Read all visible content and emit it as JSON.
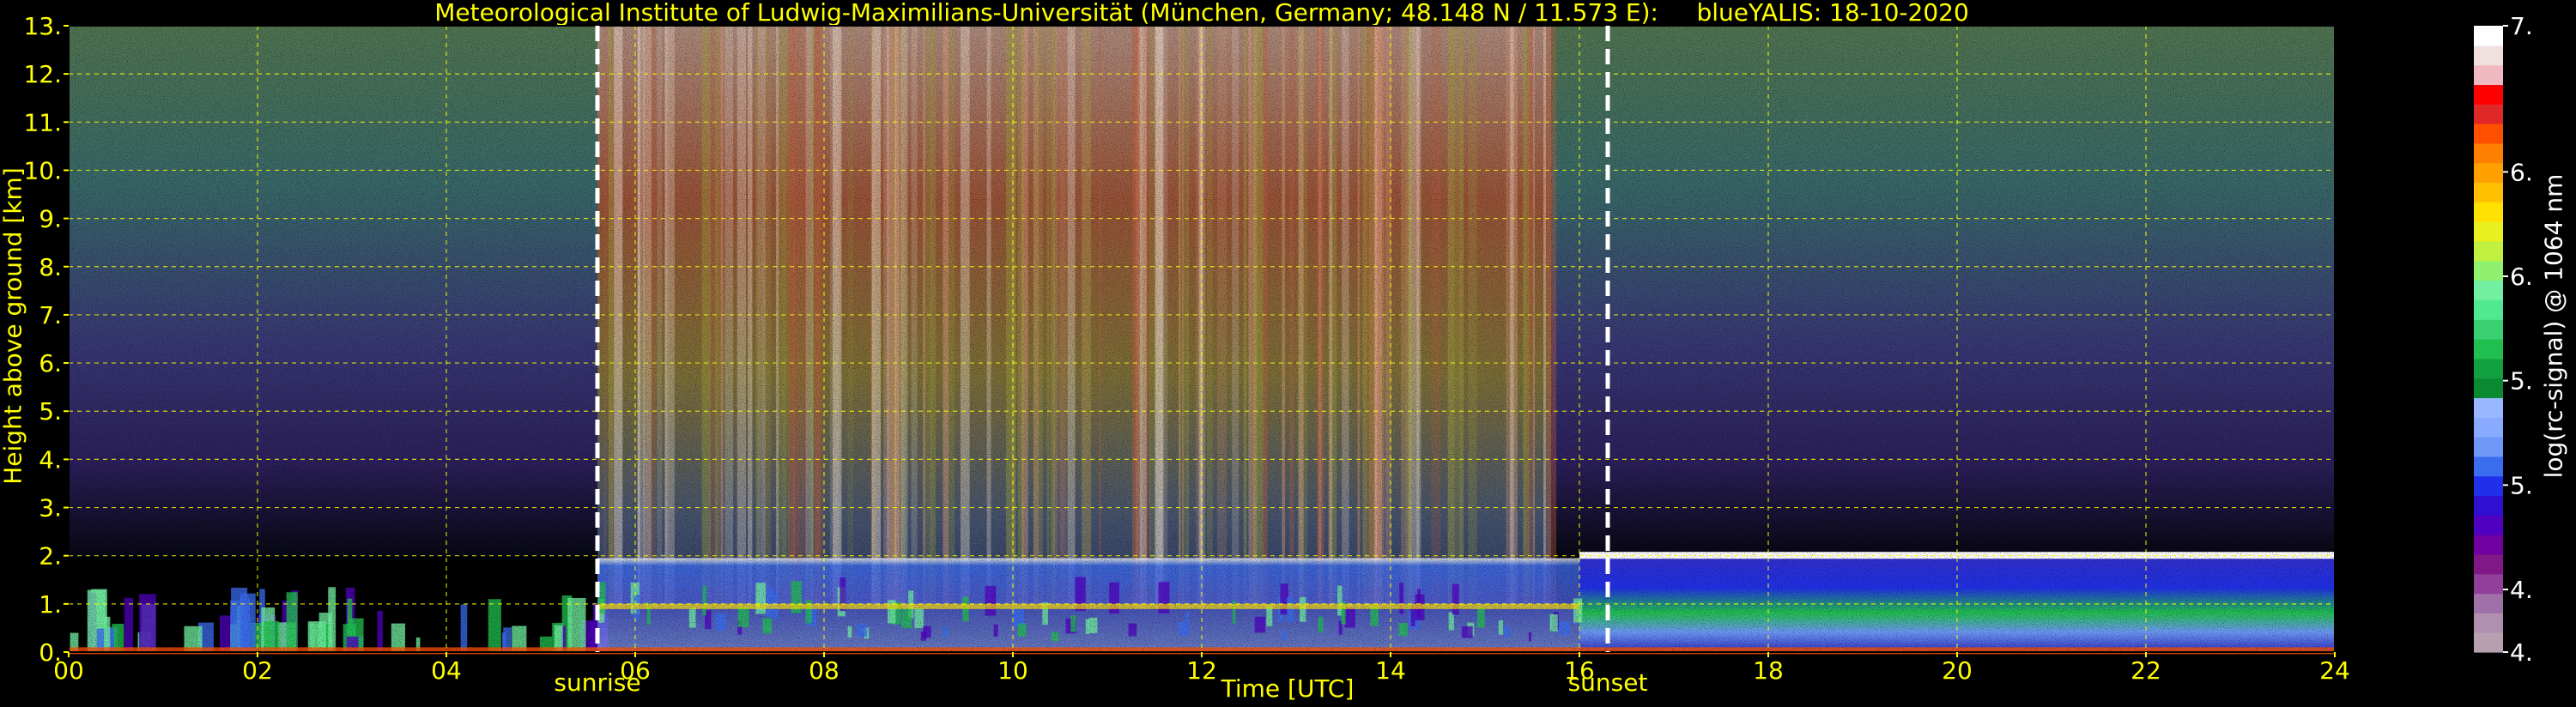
{
  "page": {
    "title": "Meteorological Institute of Ludwig-Maximilians-Universität (München, Germany; 48.148 N / 11.573 E):     blueYALIS: 18-10-2020"
  },
  "chart_data": {
    "type": "heatmap",
    "title": "Meteorological Institute of Ludwig-Maximilians-Universität (München, Germany; 48.148 N / 11.573 E):     blueYALIS: 18-10-2020",
    "xlabel": "Time [UTC]",
    "ylabel": "Height above ground [km]",
    "xlim": [
      0,
      24
    ],
    "ylim": [
      0,
      13
    ],
    "x_ticks": [
      {
        "value": 0,
        "label": "00"
      },
      {
        "value": 2,
        "label": "02"
      },
      {
        "value": 4,
        "label": "04"
      },
      {
        "value": 6,
        "label": "06"
      },
      {
        "value": 8,
        "label": "08"
      },
      {
        "value": 10,
        "label": "10"
      },
      {
        "value": 12,
        "label": "12"
      },
      {
        "value": 14,
        "label": "14"
      },
      {
        "value": 16,
        "label": "16"
      },
      {
        "value": 18,
        "label": "18"
      },
      {
        "value": 20,
        "label": "20"
      },
      {
        "value": 22,
        "label": "22"
      },
      {
        "value": 24,
        "label": "24"
      }
    ],
    "y_ticks": [
      {
        "value": 0,
        "label": "0."
      },
      {
        "value": 1,
        "label": "1."
      },
      {
        "value": 2,
        "label": "2."
      },
      {
        "value": 3,
        "label": "3."
      },
      {
        "value": 4,
        "label": "4."
      },
      {
        "value": 5,
        "label": "5."
      },
      {
        "value": 6,
        "label": "6."
      },
      {
        "value": 7,
        "label": "7."
      },
      {
        "value": 8,
        "label": "8."
      },
      {
        "value": 9,
        "label": "9."
      },
      {
        "value": 10,
        "label": "10."
      },
      {
        "value": 11,
        "label": "11."
      },
      {
        "value": 12,
        "label": "12."
      },
      {
        "value": 13,
        "label": "13."
      }
    ],
    "grid": true,
    "grid_color": "#ffff00",
    "axis_text_color": "#ffff00",
    "annotations": [
      {
        "label": "sunrise",
        "x": 5.6
      },
      {
        "label": "sunset",
        "x": 16.3
      }
    ],
    "colorbar": {
      "label": "log(rc-signal) @ 1064 nm",
      "range": [
        4.2,
        7.2
      ],
      "ticks": [
        {
          "value": 4.2,
          "label": "4.2"
        },
        {
          "value": 4.5,
          "label": "4.5"
        },
        {
          "value": 5.0,
          "label": "5.0"
        },
        {
          "value": 5.5,
          "label": "5.5"
        },
        {
          "value": 6.0,
          "label": "6.0"
        },
        {
          "value": 6.5,
          "label": "6.5"
        },
        {
          "value": 7.2,
          "label": "7.2"
        }
      ],
      "colors": [
        "#b8a0b0",
        "#b090b0",
        "#a070a8",
        "#904098",
        "#801888",
        "#7000a0",
        "#5000c0",
        "#3010d0",
        "#2030e8",
        "#3a6cf0",
        "#6d98f8",
        "#88aaff",
        "#9ab8ff",
        "#0a8a30",
        "#12a040",
        "#20c050",
        "#38d070",
        "#50e890",
        "#70f0a0",
        "#90f070",
        "#c0f040",
        "#e8f020",
        "#ffe000",
        "#ffc000",
        "#ffa000",
        "#ff8000",
        "#ff5000",
        "#e02828",
        "#ff0000",
        "#f0b8c0",
        "#f0e0e0",
        "#ffffff"
      ]
    },
    "profile_colors": {
      "aerosol_layer": [
        "#5000c0",
        "#3a6cf0",
        "#20c050",
        "#70f0a0"
      ],
      "cloud_base": [
        "#ffffff",
        "#ffe000",
        "#ff5000"
      ],
      "free_troposphere_day": [
        "#c06040",
        "#e0a080",
        "#a0a040",
        "#f0e0d0"
      ],
      "free_troposphere_night": [
        "#60a080",
        "#8080c0",
        "#6050a0"
      ]
    }
  }
}
